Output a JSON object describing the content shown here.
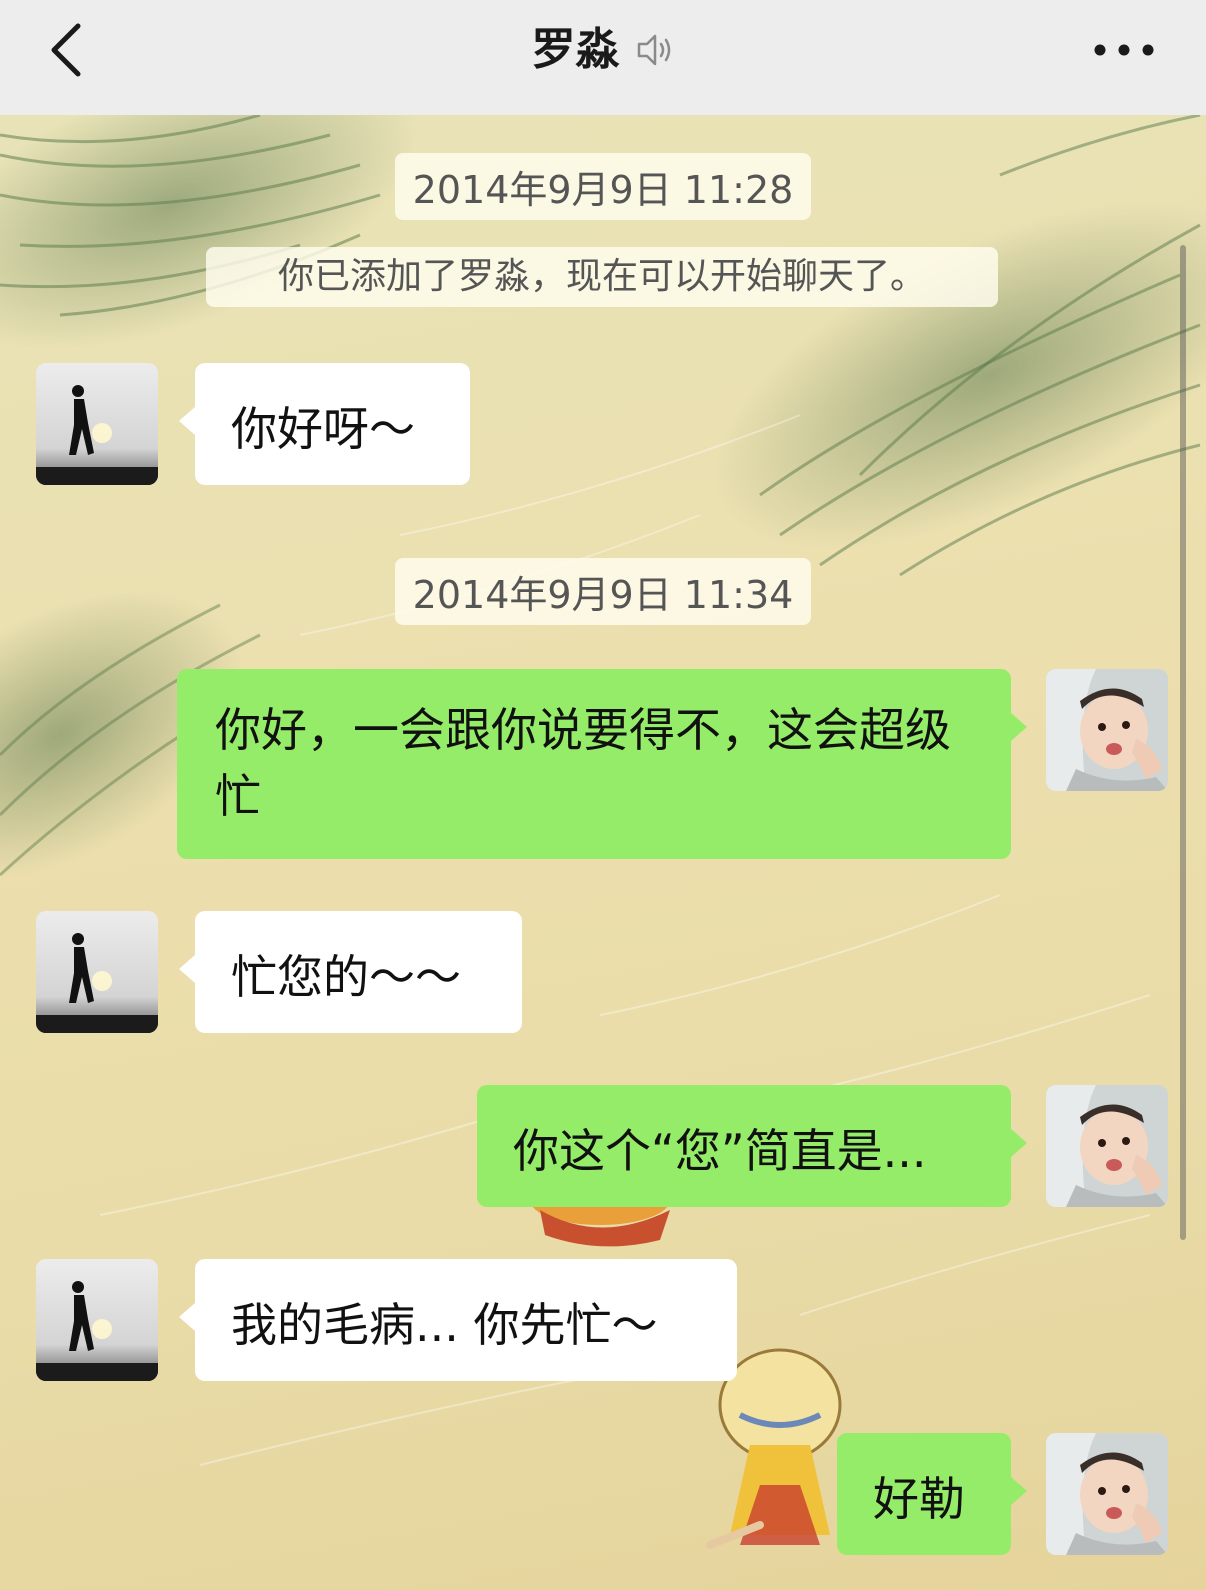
{
  "header": {
    "title": "罗淼",
    "back_icon": "chevron-left-icon",
    "mute_icon": "muted-speaker-icon",
    "more_icon": "more-dots-icon"
  },
  "chat": {
    "timestamps": [
      "2014年9月9日 11:28",
      "2014年9月9日 11:34"
    ],
    "system_note": "你已添加了罗淼，现在可以开始聊天了。",
    "messages": [
      {
        "sender": "other",
        "text": "你好呀～"
      },
      {
        "sender": "me",
        "text": "你好，一会跟你说要得不，这会超级忙"
      },
      {
        "sender": "other",
        "text": "忙您的～～"
      },
      {
        "sender": "me",
        "text": "你这个“您”简直是..."
      },
      {
        "sender": "other",
        "text": "我的毛病... 你先忙～"
      },
      {
        "sender": "me",
        "text": "好勒"
      }
    ]
  },
  "colors": {
    "header_bg": "#ededed",
    "my_bubble": "#95ec69",
    "other_bubble": "#ffffff",
    "wallpaper_base": "#ede2b6",
    "grass": "#6f8a5a"
  }
}
